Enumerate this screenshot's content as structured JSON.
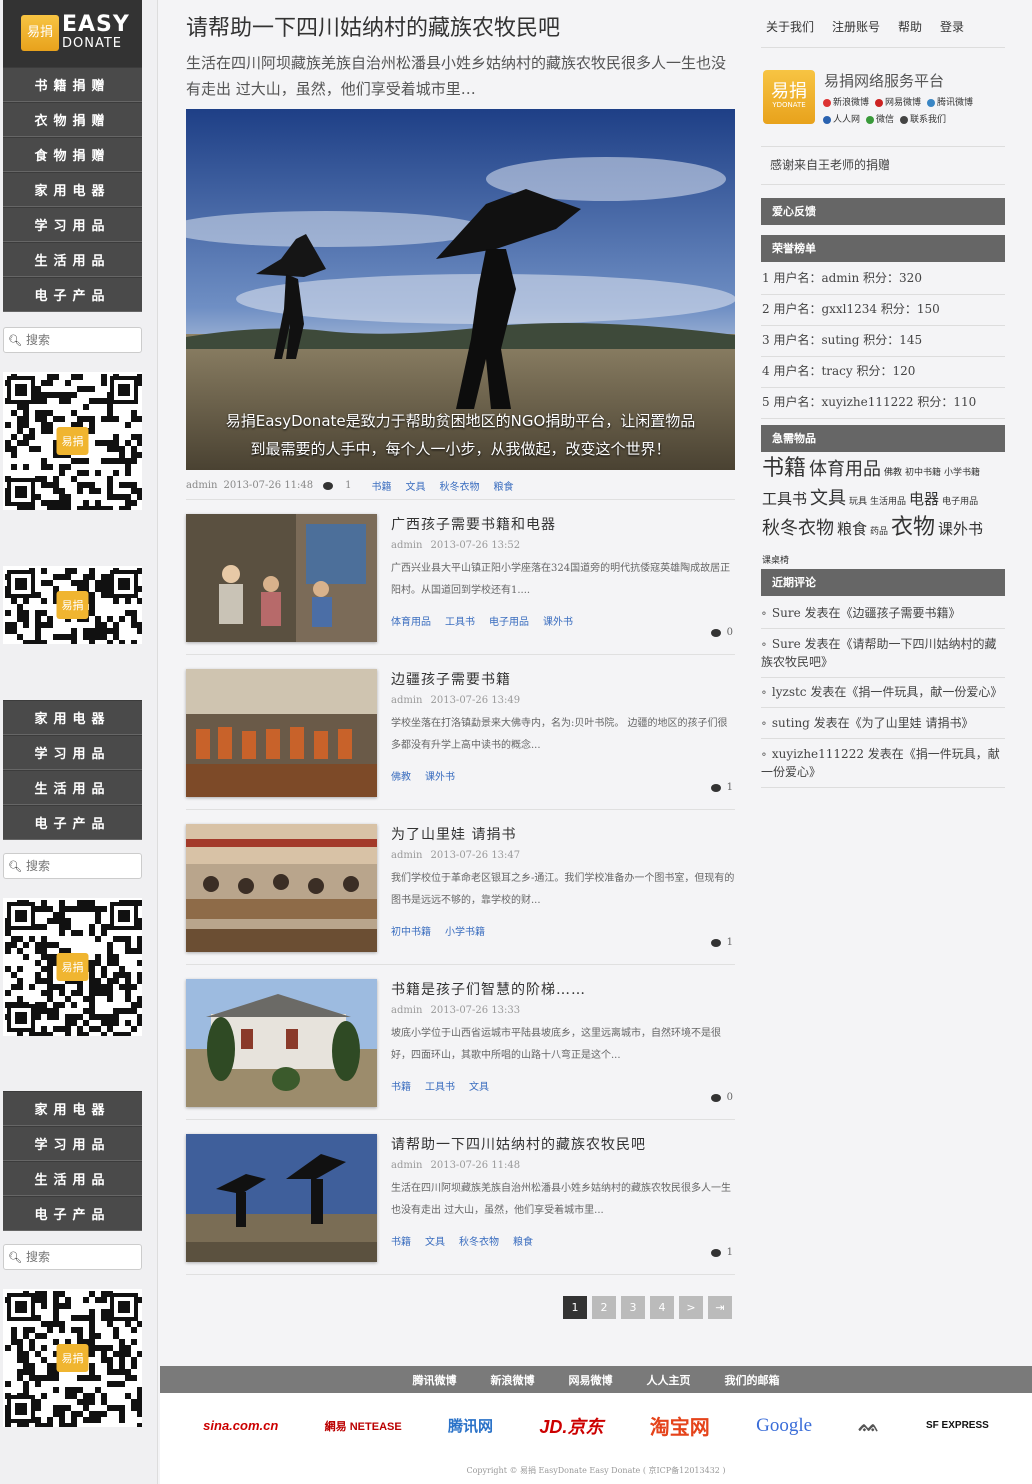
{
  "logo": {
    "icon_text": "易捐",
    "big": "EASY",
    "small": "DONATE"
  },
  "categories": [
    "书籍捐赠",
    "衣物捐赠",
    "食物捐赠",
    "家用电器",
    "学习用品",
    "生活用品",
    "电子产品"
  ],
  "categories_short": [
    "家用电器",
    "学习用品",
    "生活用品",
    "电子产品"
  ],
  "search": {
    "placeholder": "搜索"
  },
  "qr_badge": "易捐",
  "hero": {
    "title": "请帮助一下四川姑纳村的藏族农牧民吧",
    "excerpt": "生活在四川阿坝藏族羌族自治州松潘县小姓乡姑纳村的藏族农牧民很多人一生也没有走出 过大山，虽然，他们享受着城市里…",
    "caption_line1": "易捐EasyDonate是致力于帮助贫困地区的NGO捐助平台，让闲置物品",
    "caption_line2": "到最需要的人手中，每个人一小步，从我做起，改变这个世界！",
    "author": "admin",
    "date": "2013-07-26 11:48",
    "comments": "1",
    "tags": [
      "书籍",
      "文具",
      "秋冬衣物",
      "粮食"
    ]
  },
  "posts": [
    {
      "title": "广西孩子需要书籍和电器",
      "author": "admin",
      "date": "2013-07-26 13:52",
      "excerpt": "广西兴业县大平山镇正阳小学座落在324国道旁的明代抗倭寇英雄陶成故居正阳村。从国道回到学校还有1....",
      "tags": [
        "体育用品",
        "工具书",
        "电子用品",
        "课外书"
      ],
      "comments": "0"
    },
    {
      "title": "边疆孩子需要书籍",
      "author": "admin",
      "date": "2013-07-26 13:49",
      "excerpt": "学校坐落在打洛镇勐景来大佛寺内，名为:贝叶书院。 边疆的地区的孩子们很多都没有升学上高中读书的概念...",
      "tags": [
        "佛教",
        "课外书"
      ],
      "comments": "1"
    },
    {
      "title": "为了山里娃 请捐书",
      "author": "admin",
      "date": "2013-07-26 13:47",
      "excerpt": "我们学校位于革命老区银耳之乡-通江。我们学校准备办一个图书室，但现有的图书是远远不够的，靠学校的财...",
      "tags": [
        "初中书籍",
        "小学书籍"
      ],
      "comments": "1"
    },
    {
      "title": "书籍是孩子们智慧的阶梯……",
      "author": "admin",
      "date": "2013-07-26 13:33",
      "excerpt": "坡底小学位于山西省运城市平陆县坡底乡，这里远离城市，自然环境不是很好，四面环山，其歌中所唱的山路十八弯正是这个...",
      "tags": [
        "书籍",
        "工具书",
        "文具"
      ],
      "comments": "0"
    },
    {
      "title": "请帮助一下四川姑纳村的藏族农牧民吧",
      "author": "admin",
      "date": "2013-07-26 11:48",
      "excerpt": "生活在四川阿坝藏族羌族自治州松潘县小姓乡姑纳村的藏族农牧民很多人一生也没有走出 过大山，虽然，他们享受着城市里...",
      "tags": [
        "书籍",
        "文具",
        "秋冬衣物",
        "粮食"
      ],
      "comments": "1"
    }
  ],
  "pagination": [
    "1",
    "2",
    "3",
    "4",
    ">",
    "⇥"
  ],
  "topnav": [
    "关于我们",
    "注册账号",
    "帮助",
    "登录"
  ],
  "brand": {
    "icon_text": "易捐",
    "icon_sub": "YDONATE",
    "title": "易捐网络服务平台",
    "links": [
      "新浪微博",
      "网易微博",
      "腾讯微博",
      "人人网",
      "微信",
      "联系我们"
    ]
  },
  "thanks": "感谢来自王老师的捐赠",
  "widgets": {
    "feedback": "爱心反馈",
    "ranking": "荣誉榜单",
    "urgent": "急需物品",
    "comments": "近期评论"
  },
  "ranking": [
    "1 用户名：admin 积分：320",
    "2 用户名：gxxl1234 积分：150",
    "3 用户名：suting 积分：145",
    "4 用户名：tracy 积分：120",
    "5 用户名：xuyizhe111222 积分：110"
  ],
  "tagcloud": [
    {
      "t": "书籍",
      "s": "xl"
    },
    {
      "t": "体育用品",
      "s": "l"
    },
    {
      "t": "佛教",
      "s": "xs"
    },
    {
      "t": "初中书籍",
      "s": "xs"
    },
    {
      "t": "小学书籍",
      "s": "xs"
    },
    {
      "t": "工具书",
      "s": "m"
    },
    {
      "t": "文具",
      "s": "l"
    },
    {
      "t": "玩具",
      "s": "xs"
    },
    {
      "t": "生活用品",
      "s": "xs"
    },
    {
      "t": "电器",
      "s": "m"
    },
    {
      "t": "电子用品",
      "s": "xs"
    },
    {
      "t": "秋冬衣物",
      "s": "l"
    },
    {
      "t": "粮食",
      "s": "m"
    },
    {
      "t": "药品",
      "s": "xs"
    },
    {
      "t": "衣物",
      "s": "xl"
    },
    {
      "t": "课外书",
      "s": "m"
    },
    {
      "t": "课桌椅",
      "s": "xs"
    }
  ],
  "comments": [
    "Sure 发表在《边疆孩子需要书籍》",
    "Sure 发表在《请帮助一下四川姑纳村的藏族农牧民吧》",
    "lyzstc 发表在《捐一件玩具，献一份爱心》",
    "suting 发表在《为了山里娃 请捐书》",
    "xuyizhe111222 发表在《捐一件玩具，献一份爱心》"
  ],
  "footer_links": [
    "腾讯微博",
    "新浪微博",
    "网易微博",
    "人人主页",
    "我们的邮箱"
  ],
  "footer_partners": [
    "sina.com.cn",
    "網易 NETEASE",
    "腾讯网",
    "JD.京东",
    "淘宝网",
    "Google",
    "ᨐ",
    "SF EXPRESS"
  ],
  "copyright": "Copyright © 易捐 EasyDonate Easy Donate ( 京ICP备12013432 )"
}
